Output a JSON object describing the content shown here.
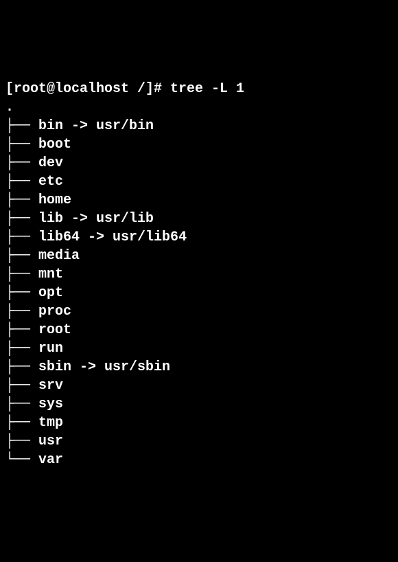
{
  "prompt": "[root@localhost /]# tree -L 1",
  "root": ".",
  "entries": [
    {
      "prefix": "├── ",
      "name": "bin",
      "link": "usr/bin"
    },
    {
      "prefix": "├── ",
      "name": "boot",
      "link": null
    },
    {
      "prefix": "├── ",
      "name": "dev",
      "link": null
    },
    {
      "prefix": "├── ",
      "name": "etc",
      "link": null
    },
    {
      "prefix": "├── ",
      "name": "home",
      "link": null
    },
    {
      "prefix": "├── ",
      "name": "lib",
      "link": "usr/lib"
    },
    {
      "prefix": "├── ",
      "name": "lib64",
      "link": "usr/lib64"
    },
    {
      "prefix": "├── ",
      "name": "media",
      "link": null
    },
    {
      "prefix": "├── ",
      "name": "mnt",
      "link": null
    },
    {
      "prefix": "├── ",
      "name": "opt",
      "link": null
    },
    {
      "prefix": "├── ",
      "name": "proc",
      "link": null
    },
    {
      "prefix": "├── ",
      "name": "root",
      "link": null
    },
    {
      "prefix": "├── ",
      "name": "run",
      "link": null
    },
    {
      "prefix": "├── ",
      "name": "sbin",
      "link": "usr/sbin"
    },
    {
      "prefix": "├── ",
      "name": "srv",
      "link": null
    },
    {
      "prefix": "├── ",
      "name": "sys",
      "link": null
    },
    {
      "prefix": "├── ",
      "name": "tmp",
      "link": null
    },
    {
      "prefix": "├── ",
      "name": "usr",
      "link": null
    },
    {
      "prefix": "└── ",
      "name": "var",
      "link": null
    }
  ]
}
